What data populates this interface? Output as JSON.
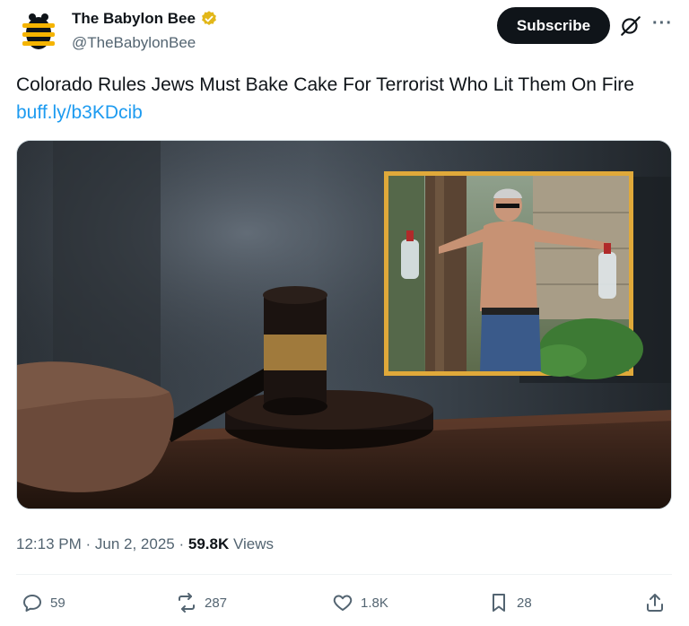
{
  "account": {
    "name": "The Babylon Bee",
    "handle": "@TheBabylonBee",
    "verified_color": "#e2b719"
  },
  "header": {
    "subscribe_label": "Subscribe",
    "icons": [
      "grok-icon",
      "more-icon"
    ]
  },
  "post": {
    "headline": "Colorado Rules Jews Must Bake Cake For Terrorist Who Lit Them On Fire",
    "link": "buff.ly/b3KDcib",
    "time": "12:13 PM",
    "date": "Jun 2, 2025",
    "views_count": "59.8K",
    "views_label": "Views"
  },
  "actions": {
    "replies": "59",
    "reposts": "287",
    "likes": "1.8K",
    "bookmarks": "28"
  },
  "colors": {
    "link": "#1d9bf0",
    "muted": "#536471",
    "inset_frame": "#e0a93a"
  }
}
